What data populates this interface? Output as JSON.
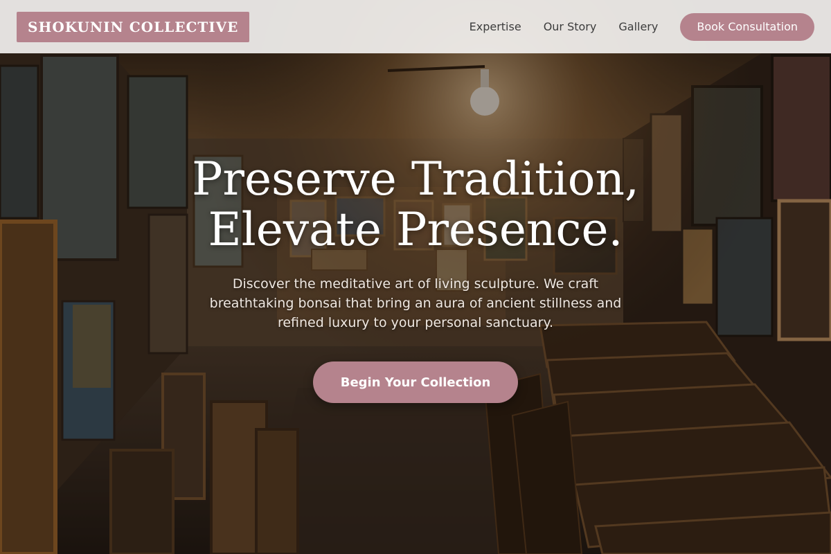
{
  "brand": {
    "name": "SHOKUNIN COLLECTIVE"
  },
  "nav": {
    "links": [
      {
        "label": "Expertise"
      },
      {
        "label": "Our Story"
      },
      {
        "label": "Gallery"
      }
    ],
    "cta_label": "Book Consultation"
  },
  "hero": {
    "title": "Preserve Tradition, Elevate Presence.",
    "subtitle": "Discover the meditative art of living sculpture. We craft breathtaking bonsai that bring an aura of ancient stillness and refined luxury to your personal sanctuary.",
    "cta_label": "Begin Your Collection",
    "background": "art-gallery-storeroom-photo"
  },
  "colors": {
    "accent": "#b5838d",
    "nav_background": "#f2f0ee",
    "nav_text": "#3c3c3c",
    "hero_text": "#ffffff"
  }
}
